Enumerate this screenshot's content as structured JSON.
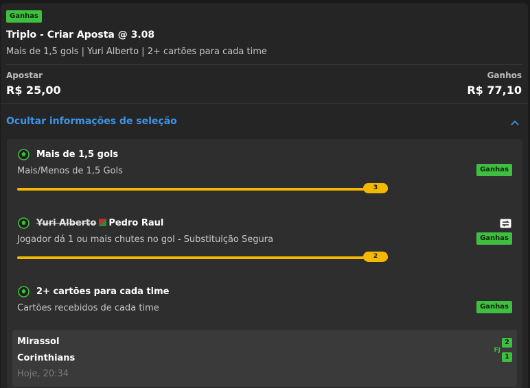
{
  "bet": {
    "status_badge": "Ganhas",
    "title": "Triplo - Criar Aposta @ 3.08",
    "summary": "Mais de 1,5 gols | Yuri Alberto | 2+ cartões para cada time",
    "stake_label": "Apostar",
    "stake_value": "R$ 25,00",
    "winnings_label": "Ganhos",
    "winnings_value": "R$ 77,10"
  },
  "toggle": {
    "label": "Ocultar informações de seleção",
    "icon": "chevron-up-icon"
  },
  "selections": [
    {
      "title": "Mais de 1,5 gols",
      "market": "Mais/Menos de 1,5 Gols",
      "result": "Ganhas",
      "progress_value": "3",
      "icon": "soccer-ball-icon"
    },
    {
      "original_player": "Yuri Alberto",
      "title": "Pedro Raul",
      "market": "Jogador dá 1 ou mais chutes no gol - Substituição Segura",
      "result": "Ganhas",
      "progress_value": "2",
      "icon": "soccer-ball-icon",
      "extra_icon": "substitution-icon"
    },
    {
      "title": "2+ cartões para cada time",
      "market": "Cartões recebidos de cada time",
      "result": "Ganhas",
      "icon": "soccer-ball-icon"
    }
  ],
  "match": {
    "home_team": "Mirassol",
    "away_team": "Corinthians",
    "time": "Hoje, 20:34",
    "status": "FJ",
    "home_score": "2",
    "away_score": "1"
  },
  "colors": {
    "background": "#252525",
    "accent_green": "#3fbf3f",
    "accent_blue": "#3d95e8",
    "progress_yellow": "#f5b800"
  }
}
